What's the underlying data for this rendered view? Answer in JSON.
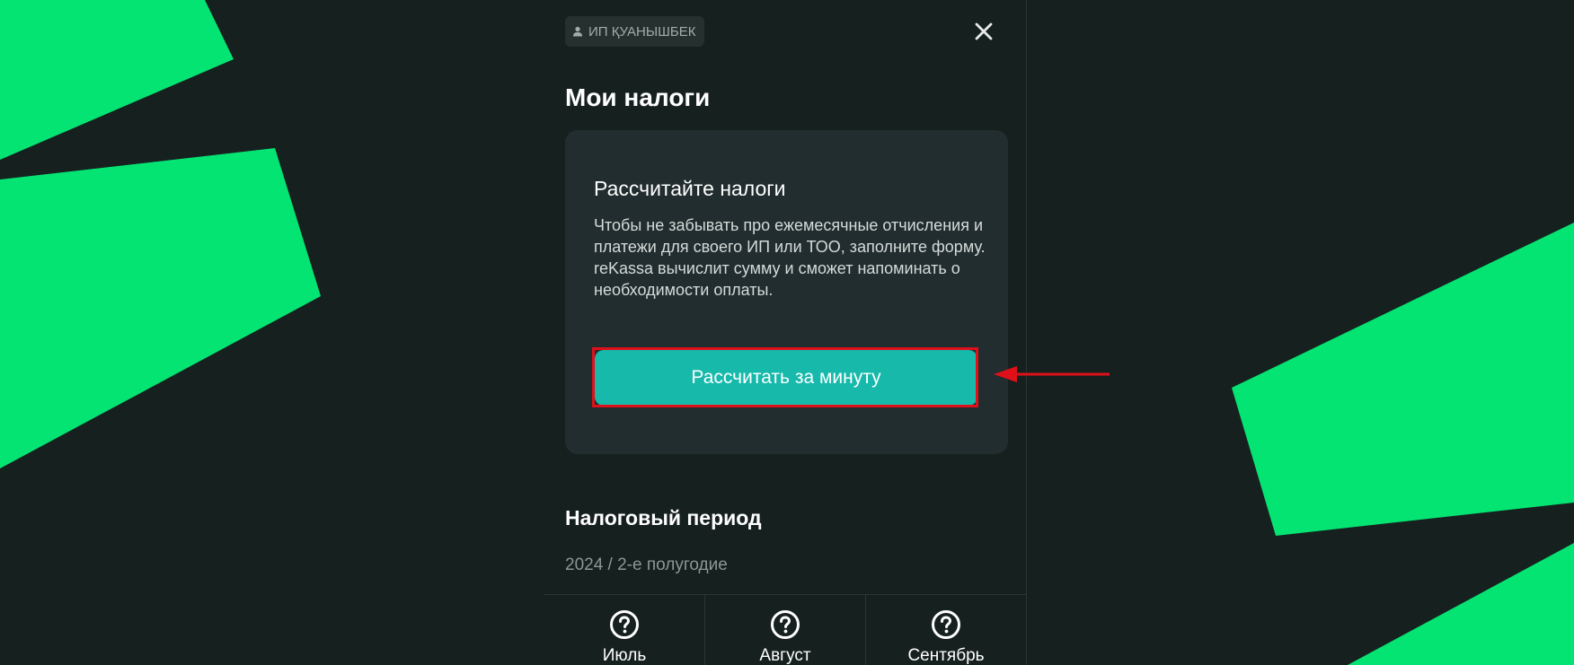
{
  "header": {
    "user_chip_label": "ИП ҚУАНЫШБЕК",
    "user_icon": "user-icon",
    "close_icon": "close-icon"
  },
  "page_title": "Мои налоги",
  "tax_card": {
    "title": "Рассчитайте налоги",
    "description": "Чтобы не забывать про ежемесячные отчисления и платежи для своего ИП или ТОО, заполните форму. reKassa вычислит сумму и сможет напоминать о необходимости оплаты.",
    "button_label": "Рассчитать за минуту"
  },
  "tax_period": {
    "title": "Налоговый период",
    "value": "2024 / 2-е полугодие",
    "months": [
      {
        "label": "Июль",
        "icon": "question-icon"
      },
      {
        "label": "Август",
        "icon": "question-icon"
      },
      {
        "label": "Сентябрь",
        "icon": "question-icon"
      }
    ]
  },
  "colors": {
    "background": "#16201f",
    "card": "#212d2f",
    "accent_button": "#17b9ab",
    "decor_green": "#04e472",
    "highlight_red": "#e0101a"
  }
}
